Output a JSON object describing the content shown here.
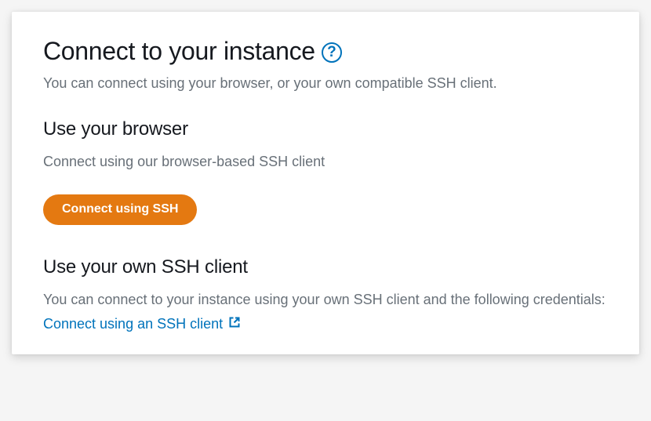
{
  "header": {
    "title": "Connect to your instance",
    "help_tooltip": "?",
    "subtitle": "You can connect using your browser, or your own compatible SSH client."
  },
  "sections": {
    "browser": {
      "heading": "Use your browser",
      "description": "Connect using our browser-based SSH client",
      "button_label": "Connect using SSH"
    },
    "own_client": {
      "heading": "Use your own SSH client",
      "description": "You can connect to your instance using your own SSH client and the following credentials:",
      "link_label": "Connect using an SSH client"
    }
  },
  "colors": {
    "accent_orange": "#e47911",
    "link_blue": "#0073bb",
    "text_dark": "#16191f",
    "text_muted": "#687078"
  }
}
